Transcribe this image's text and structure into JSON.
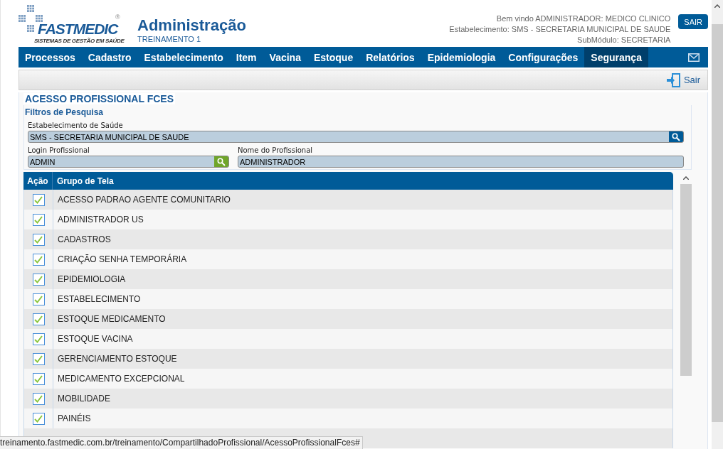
{
  "logo": {
    "name": "FASTMEDIC",
    "registered": "®",
    "tagline": "SISTEMAS DE GESTÃO EM SAÚDE"
  },
  "header": {
    "title": "Administração",
    "subtitle": "TREINAMENTO 1",
    "user_info": [
      "Bem vindo ADMINISTRADOR: MEDICO CLINICO",
      "Estabelecimento: SMS - SECRETARIA MUNICIPAL DE SAUDE",
      "SubMódulo: SECRETARIA"
    ],
    "logout_button": "SAIR"
  },
  "nav": [
    {
      "label": "Processos",
      "selected": false
    },
    {
      "label": "Cadastro",
      "selected": false
    },
    {
      "label": "Estabelecimento",
      "selected": false
    },
    {
      "label": "Item",
      "selected": false
    },
    {
      "label": "Vacina",
      "selected": false
    },
    {
      "label": "Estoque",
      "selected": false
    },
    {
      "label": "Relatórios",
      "selected": false
    },
    {
      "label": "Epidemiologia",
      "selected": false
    },
    {
      "label": "Configurações",
      "selected": false
    },
    {
      "label": "Segurança",
      "selected": true
    }
  ],
  "toolbar": {
    "exit_button": "Sair"
  },
  "section": {
    "title": "ACESSO PROFISSIONAL FCES",
    "filters": {
      "title": "Filtros de Pesquisa",
      "establishment": {
        "label": "Estabelecimento de Saúde",
        "value": "SMS - SECRETARIA MUNICIPAL DE SAUDE"
      },
      "login": {
        "label": "Login Profissional",
        "value": "ADMIN"
      },
      "professional_name": {
        "label": "Nome do Profissional",
        "value": "ADMINISTRADOR"
      }
    }
  },
  "table": {
    "columns": [
      "Ação",
      "Grupo de Tela"
    ],
    "rows": [
      {
        "checked": true,
        "label": "ACESSO PADRAO AGENTE COMUNITARIO"
      },
      {
        "checked": true,
        "label": "ADMINISTRADOR US"
      },
      {
        "checked": true,
        "label": "CADASTROS"
      },
      {
        "checked": true,
        "label": "CRIAÇÃO SENHA TEMPORÁRIA"
      },
      {
        "checked": true,
        "label": "EPIDEMIOLOGIA"
      },
      {
        "checked": true,
        "label": "ESTABELECIMENTO"
      },
      {
        "checked": true,
        "label": "ESTOQUE MEDICAMENTO"
      },
      {
        "checked": true,
        "label": "ESTOQUE VACINA"
      },
      {
        "checked": true,
        "label": "GERENCIAMENTO ESTOQUE"
      },
      {
        "checked": true,
        "label": "MEDICAMENTO EXCEPCIONAL"
      },
      {
        "checked": true,
        "label": "MOBILIDADE"
      },
      {
        "checked": true,
        "label": "PAINÉIS"
      }
    ]
  },
  "status_bar": {
    "url": "treinamento.fastmedic.com.br/treinamento/CompartilhadoProfissional/AcessoProfissionalFces#"
  }
}
